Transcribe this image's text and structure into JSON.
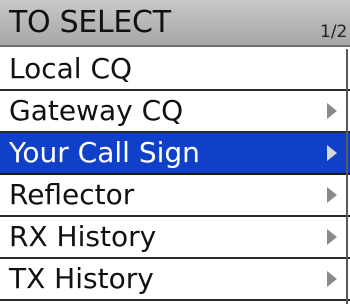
{
  "header": {
    "title": "TO SELECT",
    "page_indicator": "1/2"
  },
  "menu": {
    "items": [
      {
        "label": "Local CQ",
        "has_submenu": false,
        "selected": false
      },
      {
        "label": "Gateway CQ",
        "has_submenu": true,
        "selected": false
      },
      {
        "label": "Your Call Sign",
        "has_submenu": true,
        "selected": true
      },
      {
        "label": "Reflector",
        "has_submenu": true,
        "selected": false
      },
      {
        "label": "RX History",
        "has_submenu": true,
        "selected": false
      },
      {
        "label": "TX History",
        "has_submenu": true,
        "selected": false
      }
    ]
  },
  "icons": {
    "submenu_arrow": "chevron-right-icon"
  },
  "colors": {
    "selection": "#1040c8",
    "header_gray": "#b5b5b5",
    "text": "#111111",
    "selected_text": "#ffffff",
    "arrow_gray": "#8a8a8a",
    "arrow_selected": "#d8d8d8"
  }
}
